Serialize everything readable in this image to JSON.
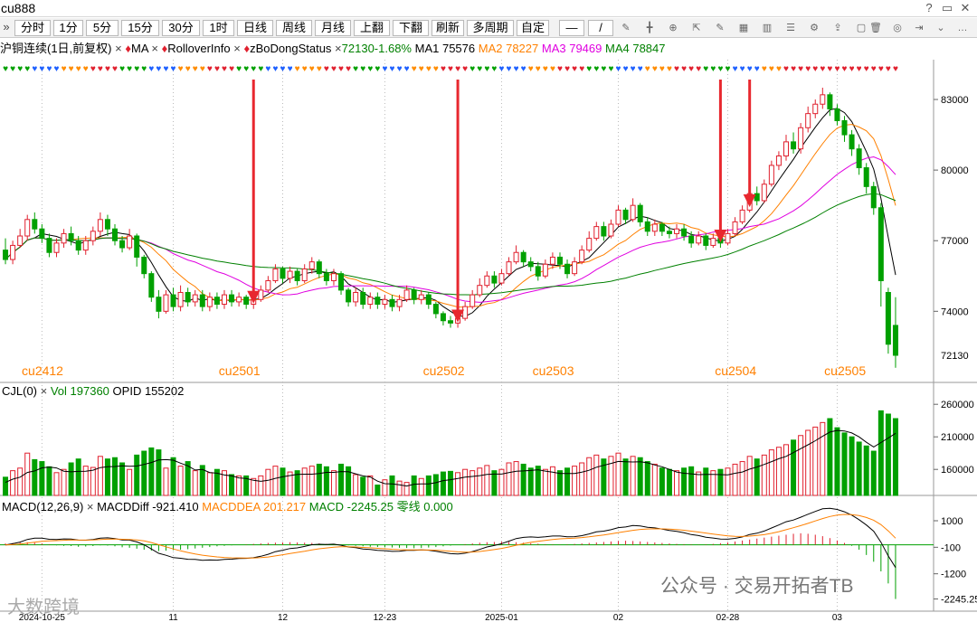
{
  "window": {
    "title": "cu888"
  },
  "toolbar": {
    "collapse": "»",
    "periods": [
      "分时",
      "1分",
      "5分",
      "15分",
      "30分",
      "1时",
      "日线",
      "周线",
      "月线"
    ],
    "actions": [
      "上翻",
      "下翻",
      "刷新",
      "多周期",
      "自定"
    ]
  },
  "legend": {
    "symbol": "沪铜连续(1日,前复权)",
    "indicators": [
      "MA",
      "RolloverInfo",
      "zBoDongStatus"
    ],
    "price_change": "72130-1.68%",
    "ma1": "MA1 75576",
    "ma2": "MA2 78227",
    "ma3": "MA3 79469",
    "ma4": "MA4 78847"
  },
  "volume_legend": {
    "name": "CJL(0)",
    "vol": "Vol 197360",
    "opid": "OPID 155202"
  },
  "macd_legend": {
    "name": "MACD(12,26,9)",
    "diff": "MACDDiff -921.410",
    "dea": "MACDDEA 201.217",
    "macd": "MACD -2245.25",
    "zero": "零线 0.000"
  },
  "contracts": [
    {
      "label": "cu2412",
      "idx": 0
    },
    {
      "label": "cu2501",
      "idx": 27
    },
    {
      "label": "cu2502",
      "idx": 55
    },
    {
      "label": "cu2503",
      "idx": 70
    },
    {
      "label": "cu2504",
      "idx": 95
    },
    {
      "label": "cu2505",
      "idx": 110
    }
  ],
  "date_labels": [
    {
      "label": "2024-10-25",
      "idx": 5
    },
    {
      "label": "11",
      "idx": 23
    },
    {
      "label": "12",
      "idx": 38
    },
    {
      "label": "12-23",
      "idx": 52
    },
    {
      "label": "2025-01",
      "idx": 68
    },
    {
      "label": "02",
      "idx": 84
    },
    {
      "label": "02-28",
      "idx": 99
    },
    {
      "label": "03",
      "idx": 114
    }
  ],
  "watermarks": {
    "left": "大数跨境",
    "right": "公众号 · 交易开拓者TB"
  },
  "colors": {
    "up": "#e0202e",
    "down": "#00a000",
    "ma1": "#000000",
    "ma2": "#ff8000",
    "ma3": "#e000e0",
    "ma4": "#008000",
    "arrow": "#e8282f"
  },
  "chart_data": {
    "type": "candlestick",
    "price_axis": {
      "ticks": [
        83000,
        80000,
        77000,
        74000
      ],
      "last": 72130,
      "range": [
        71400,
        84000
      ]
    },
    "volume_axis": {
      "ticks": [
        260000,
        210000,
        160000
      ],
      "range": [
        120000,
        270000
      ]
    },
    "macd_axis": {
      "ticks": [
        1000,
        -100,
        -1200,
        -2245.25
      ],
      "range": [
        -2600,
        1300
      ]
    },
    "arrows_at": [
      34,
      62,
      98,
      102
    ],
    "candles": [
      [
        76600,
        76200,
        77100,
        76000,
        148000
      ],
      [
        76200,
        76800,
        77000,
        76000,
        158000
      ],
      [
        76800,
        77200,
        77500,
        76700,
        162000
      ],
      [
        77200,
        77900,
        78100,
        77000,
        185000
      ],
      [
        77900,
        77500,
        78200,
        77300,
        175000
      ],
      [
        77500,
        77100,
        77700,
        76900,
        172000
      ],
      [
        77100,
        76500,
        77300,
        76300,
        164000
      ],
      [
        76500,
        76900,
        77100,
        76300,
        155000
      ],
      [
        76900,
        77300,
        77500,
        76700,
        160000
      ],
      [
        77300,
        77000,
        77600,
        76800,
        170000
      ],
      [
        77000,
        76600,
        77200,
        76400,
        176000
      ],
      [
        76600,
        77000,
        77200,
        76400,
        165000
      ],
      [
        77000,
        77400,
        77600,
        76800,
        163000
      ],
      [
        77400,
        77900,
        78200,
        77200,
        180000
      ],
      [
        77900,
        77500,
        78100,
        77200,
        176000
      ],
      [
        77500,
        77000,
        77700,
        76800,
        178000
      ],
      [
        77000,
        76700,
        77200,
        76500,
        170000
      ],
      [
        76700,
        77200,
        77500,
        76600,
        160000
      ],
      [
        77200,
        76300,
        77300,
        75900,
        182000
      ],
      [
        76300,
        75600,
        76400,
        75400,
        188000
      ],
      [
        75600,
        74600,
        75700,
        74400,
        193000
      ],
      [
        74600,
        74000,
        74900,
        73700,
        190000
      ],
      [
        74000,
        74700,
        74900,
        73900,
        162000
      ],
      [
        74700,
        74200,
        75000,
        74000,
        178000
      ],
      [
        74200,
        74800,
        75100,
        74000,
        165000
      ],
      [
        74800,
        74400,
        75000,
        74200,
        172000
      ],
      [
        74400,
        74700,
        74900,
        74200,
        158000
      ],
      [
        74700,
        74200,
        74900,
        74000,
        166000
      ],
      [
        74200,
        74600,
        74800,
        74000,
        155000
      ],
      [
        74600,
        74300,
        74800,
        74100,
        160000
      ],
      [
        74300,
        74700,
        74900,
        74100,
        158000
      ],
      [
        74700,
        74400,
        74900,
        74200,
        152000
      ],
      [
        74400,
        74600,
        74800,
        74200,
        150000
      ],
      [
        74600,
        74300,
        74700,
        74100,
        150000
      ],
      [
        74300,
        74500,
        74700,
        74100,
        146000
      ],
      [
        74500,
        74900,
        75100,
        74400,
        150000
      ],
      [
        74900,
        75300,
        75500,
        74800,
        160000
      ],
      [
        75300,
        75800,
        76000,
        75200,
        165000
      ],
      [
        75800,
        75400,
        75900,
        75200,
        162000
      ],
      [
        75400,
        75700,
        75900,
        75200,
        156000
      ],
      [
        75700,
        75300,
        75800,
        75100,
        158000
      ],
      [
        75300,
        75800,
        76000,
        75200,
        162000
      ],
      [
        75800,
        76100,
        76300,
        75600,
        165000
      ],
      [
        76100,
        75600,
        76200,
        75400,
        168000
      ],
      [
        75600,
        75300,
        75800,
        75100,
        164000
      ],
      [
        75300,
        75600,
        75800,
        75100,
        158000
      ],
      [
        75600,
        74900,
        75700,
        74700,
        168000
      ],
      [
        74900,
        74400,
        75000,
        74200,
        164000
      ],
      [
        74400,
        74800,
        75000,
        74200,
        152000
      ],
      [
        74800,
        74300,
        75000,
        74100,
        148000
      ],
      [
        74300,
        74600,
        74800,
        74100,
        150000
      ],
      [
        74600,
        74300,
        74800,
        74100,
        136000
      ],
      [
        74300,
        74500,
        74700,
        74100,
        144000
      ],
      [
        74500,
        74200,
        74700,
        74000,
        150000
      ],
      [
        74200,
        74500,
        74700,
        74000,
        142000
      ],
      [
        74500,
        74900,
        75100,
        74400,
        140000
      ],
      [
        74900,
        74500,
        75000,
        74300,
        150000
      ],
      [
        74500,
        74700,
        74900,
        74300,
        146000
      ],
      [
        74700,
        74300,
        74800,
        74100,
        150000
      ],
      [
        74300,
        73900,
        74400,
        73700,
        152000
      ],
      [
        73900,
        73600,
        74000,
        73400,
        156000
      ],
      [
        73600,
        73500,
        73800,
        73300,
        157000
      ],
      [
        73500,
        73700,
        73900,
        73300,
        155000
      ],
      [
        73700,
        74200,
        74400,
        73600,
        160000
      ],
      [
        74200,
        74700,
        74900,
        74100,
        158000
      ],
      [
        74700,
        75100,
        75400,
        74600,
        162000
      ],
      [
        75100,
        75500,
        75700,
        75000,
        166000
      ],
      [
        75500,
        75200,
        75700,
        75000,
        158000
      ],
      [
        75200,
        75600,
        75800,
        75100,
        160000
      ],
      [
        75600,
        76100,
        76300,
        75500,
        170000
      ],
      [
        76100,
        76500,
        76800,
        76000,
        172000
      ],
      [
        76500,
        76100,
        76600,
        75900,
        168000
      ],
      [
        76100,
        75900,
        76300,
        75700,
        162000
      ],
      [
        75900,
        75500,
        76100,
        75300,
        165000
      ],
      [
        75500,
        76000,
        76200,
        75400,
        160000
      ],
      [
        76000,
        76300,
        76500,
        75800,
        164000
      ],
      [
        76300,
        76000,
        76500,
        75800,
        158000
      ],
      [
        76000,
        75600,
        76200,
        75400,
        162000
      ],
      [
        75600,
        76100,
        76300,
        75500,
        165000
      ],
      [
        76100,
        76600,
        76800,
        76000,
        170000
      ],
      [
        76600,
        77100,
        77400,
        76500,
        178000
      ],
      [
        77100,
        77600,
        77800,
        77000,
        182000
      ],
      [
        77600,
        77200,
        77800,
        77000,
        176000
      ],
      [
        77200,
        77700,
        77900,
        77100,
        180000
      ],
      [
        77700,
        78300,
        78500,
        77600,
        185000
      ],
      [
        78300,
        77900,
        78400,
        77700,
        176000
      ],
      [
        77900,
        78500,
        78800,
        77800,
        180000
      ],
      [
        78500,
        77800,
        78600,
        77600,
        178000
      ],
      [
        77800,
        77400,
        78000,
        77200,
        172000
      ],
      [
        77400,
        77700,
        77900,
        77200,
        168000
      ],
      [
        77700,
        77400,
        77800,
        77200,
        162000
      ],
      [
        77400,
        77300,
        77600,
        77100,
        160000
      ],
      [
        77300,
        77500,
        77700,
        77100,
        158000
      ],
      [
        77500,
        77200,
        77700,
        77000,
        162000
      ],
      [
        77200,
        76900,
        77400,
        76700,
        164000
      ],
      [
        76900,
        77200,
        77400,
        76800,
        156000
      ],
      [
        77200,
        76800,
        77300,
        76600,
        162000
      ],
      [
        76800,
        77100,
        77300,
        76700,
        158000
      ],
      [
        77100,
        76900,
        77300,
        76700,
        160000
      ],
      [
        76900,
        77300,
        77500,
        76800,
        162000
      ],
      [
        77300,
        77800,
        78000,
        77200,
        168000
      ],
      [
        77800,
        78300,
        78500,
        77700,
        172000
      ],
      [
        78300,
        79000,
        79200,
        78200,
        180000
      ],
      [
        79000,
        78700,
        79300,
        78500,
        176000
      ],
      [
        78700,
        79400,
        79600,
        78600,
        182000
      ],
      [
        79400,
        80200,
        80400,
        79300,
        190000
      ],
      [
        80200,
        80600,
        80800,
        80000,
        194000
      ],
      [
        80600,
        81200,
        81500,
        80400,
        198000
      ],
      [
        81200,
        80900,
        81600,
        80700,
        205000
      ],
      [
        80900,
        81800,
        82000,
        80700,
        212000
      ],
      [
        81800,
        82400,
        82700,
        81600,
        220000
      ],
      [
        82400,
        82800,
        83000,
        82200,
        225000
      ],
      [
        82800,
        83200,
        83500,
        82600,
        232000
      ],
      [
        83200,
        82600,
        83300,
        82300,
        238000
      ],
      [
        82600,
        82100,
        82800,
        81900,
        224000
      ],
      [
        82100,
        81500,
        82300,
        81200,
        216000
      ],
      [
        81500,
        80900,
        81700,
        80600,
        210000
      ],
      [
        80900,
        80100,
        81100,
        79800,
        202000
      ],
      [
        80100,
        79300,
        80300,
        79000,
        196000
      ],
      [
        79300,
        78400,
        79500,
        78100,
        188000
      ],
      [
        78400,
        75300,
        78600,
        74200,
        250000
      ],
      [
        74800,
        72600,
        75000,
        72200,
        245000
      ],
      [
        73400,
        72130,
        74600,
        71600,
        238000
      ]
    ],
    "macd_hist": [
      60,
      80,
      90,
      110,
      90,
      60,
      20,
      -20,
      -40,
      -50,
      -80,
      -70,
      -50,
      -20,
      -30,
      -60,
      -100,
      -120,
      -160,
      -200,
      -240,
      -260,
      -240,
      -220,
      -200,
      -180,
      -150,
      -120,
      -90,
      -60,
      -40,
      -20,
      0,
      20,
      40,
      60,
      80,
      90,
      100,
      110,
      100,
      90,
      80,
      60,
      40,
      20,
      0,
      -20,
      -40,
      -60,
      -80,
      -90,
      -100,
      -110,
      -120,
      -130,
      -140,
      -130,
      -110,
      -90,
      -60,
      -30,
      0,
      30,
      60,
      90,
      110,
      120,
      130,
      120,
      110,
      90,
      70,
      50,
      30,
      20,
      10,
      20,
      40,
      60,
      80,
      100,
      120,
      140,
      160,
      170,
      160,
      140,
      120,
      100,
      80,
      60,
      40,
      30,
      20,
      10,
      20,
      40,
      70,
      100,
      140,
      180,
      220,
      260,
      300,
      340,
      380,
      420,
      460,
      480,
      460,
      420,
      360,
      280,
      180,
      80,
      -40,
      -200,
      -420,
      -700,
      -1100,
      -1600,
      -2245.25
    ]
  }
}
